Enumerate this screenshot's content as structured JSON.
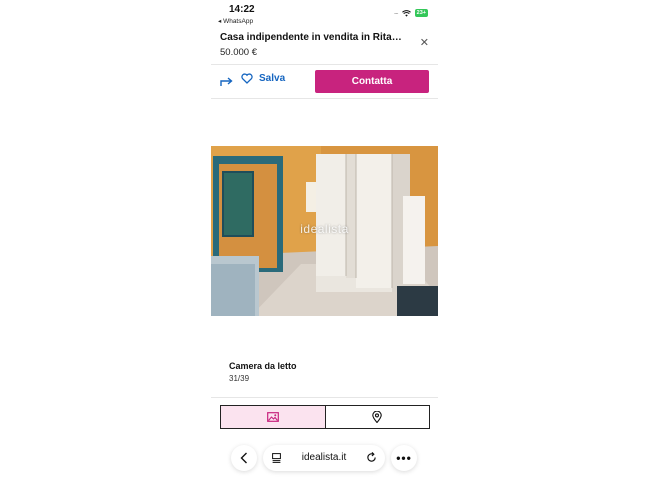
{
  "status_bar": {
    "time": "14:22",
    "back_app": "◂ WhatsApp",
    "battery": "23+",
    "signal": "....",
    "wifi_icon": "wifi-icon"
  },
  "header": {
    "title": "Casa indipendente in vendita in Rita…",
    "price": "50.000 €",
    "close_icon": "close-icon"
  },
  "actions": {
    "share_icon": "share-arrow-icon",
    "save_label": "Salva",
    "contact_label": "Contatta",
    "accent_color": "#c8237e",
    "link_color": "#1565c0"
  },
  "photo": {
    "watermark": "idealista",
    "caption": "Camera da letto",
    "counter": "31/39"
  },
  "tabs": [
    {
      "icon": "image-icon",
      "active": true
    },
    {
      "icon": "map-pin-icon",
      "active": false
    }
  ],
  "browser": {
    "url": "idealista.it",
    "back_icon": "chevron-left-icon",
    "reader_icon": "reader-icon",
    "reload_icon": "reload-icon",
    "more_label": "•••"
  }
}
